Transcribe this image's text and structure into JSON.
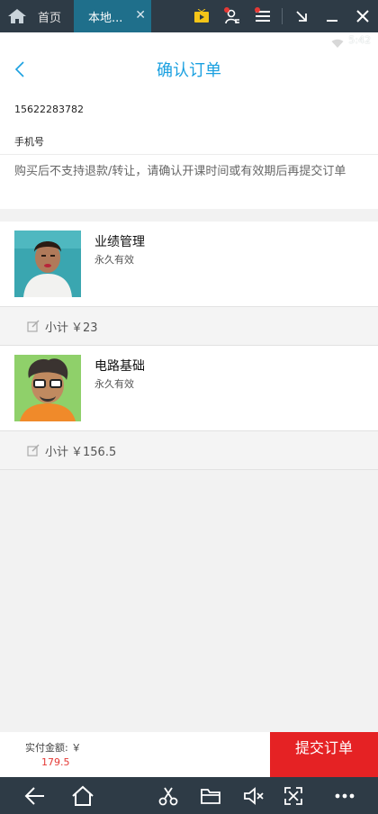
{
  "emulator": {
    "tabs": [
      {
        "label": "首页"
      },
      {
        "label": "本地...",
        "close": "✕"
      }
    ]
  },
  "status": {
    "time": "5:42"
  },
  "header": {
    "back": "‹",
    "title": "确认订单"
  },
  "contact": {
    "phone": "15622283782",
    "phone_label": "手机号"
  },
  "notice": "购买后不支持退款/转让，请确认开课时间或有效期后再提交订单",
  "items": [
    {
      "name": "业绩管理",
      "validity": "永久有效",
      "subtotal_label": "小计",
      "subtotal": "￥23"
    },
    {
      "name": "电路基础",
      "validity": "永久有效",
      "subtotal_label": "小计",
      "subtotal": "￥156.5"
    }
  ],
  "footer": {
    "pay_label": "实付金额: ￥",
    "pay_amount": "179.5",
    "submit": "提交订单"
  },
  "colors": {
    "accent": "#1aa0e0",
    "submit": "#e52224",
    "price": "#e53935",
    "emulator_bar": "#2e3b46"
  }
}
